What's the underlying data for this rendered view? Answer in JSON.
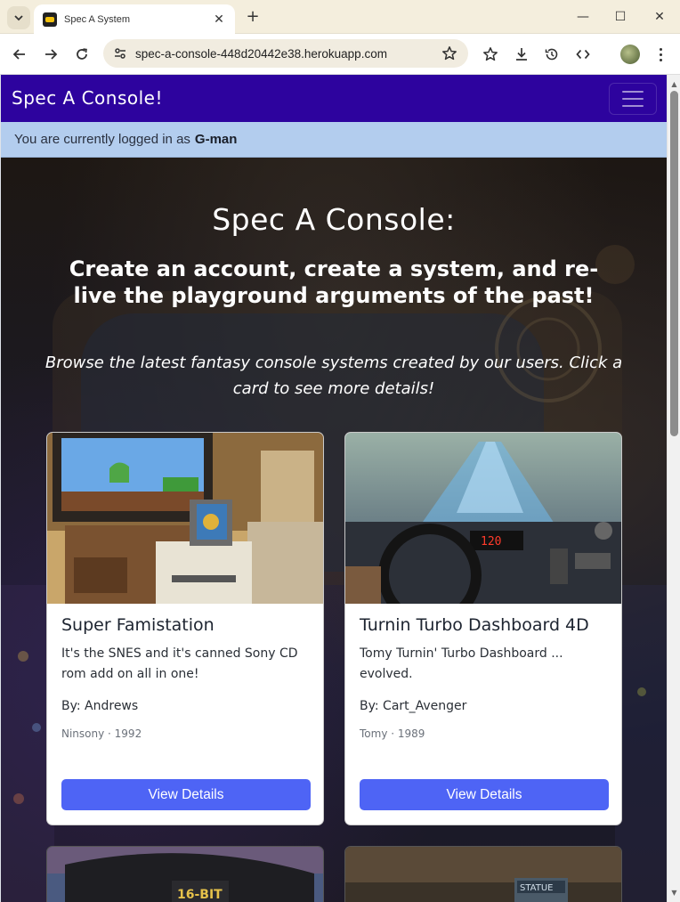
{
  "browser": {
    "tab_title": "Spec A System",
    "url": "spec-a-console-448d20442e38.herokuapp.com"
  },
  "site": {
    "brand": "Spec A Console!",
    "login_prefix": "You are currently logged in as",
    "username": "G-man"
  },
  "hero": {
    "title": "Spec A Console:",
    "subtitle": "Create an account, create a system, and re-live the playground arguments of the past!",
    "intro": "Browse the latest fantasy console systems created by our users. Click a card to see more details!"
  },
  "cards": [
    {
      "title": "Super Famistation",
      "description": "It's the SNES and it's canned Sony CD rom add on all in one!",
      "author": "By: Andrews",
      "meta": "Ninsony · 1992",
      "button": "View Details"
    },
    {
      "title": "Turnin Turbo Dashboard 4D",
      "description": "Tomy Turnin' Turbo Dashboard ... evolved.",
      "author": "By: Cart_Avenger",
      "meta": "Tomy · 1989",
      "button": "View Details",
      "display_readout": "120"
    }
  ],
  "peek_cards": [
    {
      "image_text": "16-BIT"
    },
    {
      "image_text": "STATUE"
    }
  ],
  "colors": {
    "navbar": "#2d039e",
    "login_bar": "#b3cdee",
    "button": "#4e64f5"
  },
  "icons": {
    "tab_menu": "chevron-down-icon",
    "favicon": "game-controller-icon",
    "close": "close-icon",
    "new_tab": "plus-icon",
    "back": "arrow-left-icon",
    "forward": "arrow-right-icon",
    "reload": "reload-icon",
    "site_info": "tune-icon",
    "bookmark": "star-icon",
    "bookmarks": "star-list-icon",
    "downloads": "download-icon",
    "history": "history-icon",
    "devtools": "code-icon",
    "menu": "kebab-menu-icon",
    "hamburger": "hamburger-menu-icon"
  }
}
